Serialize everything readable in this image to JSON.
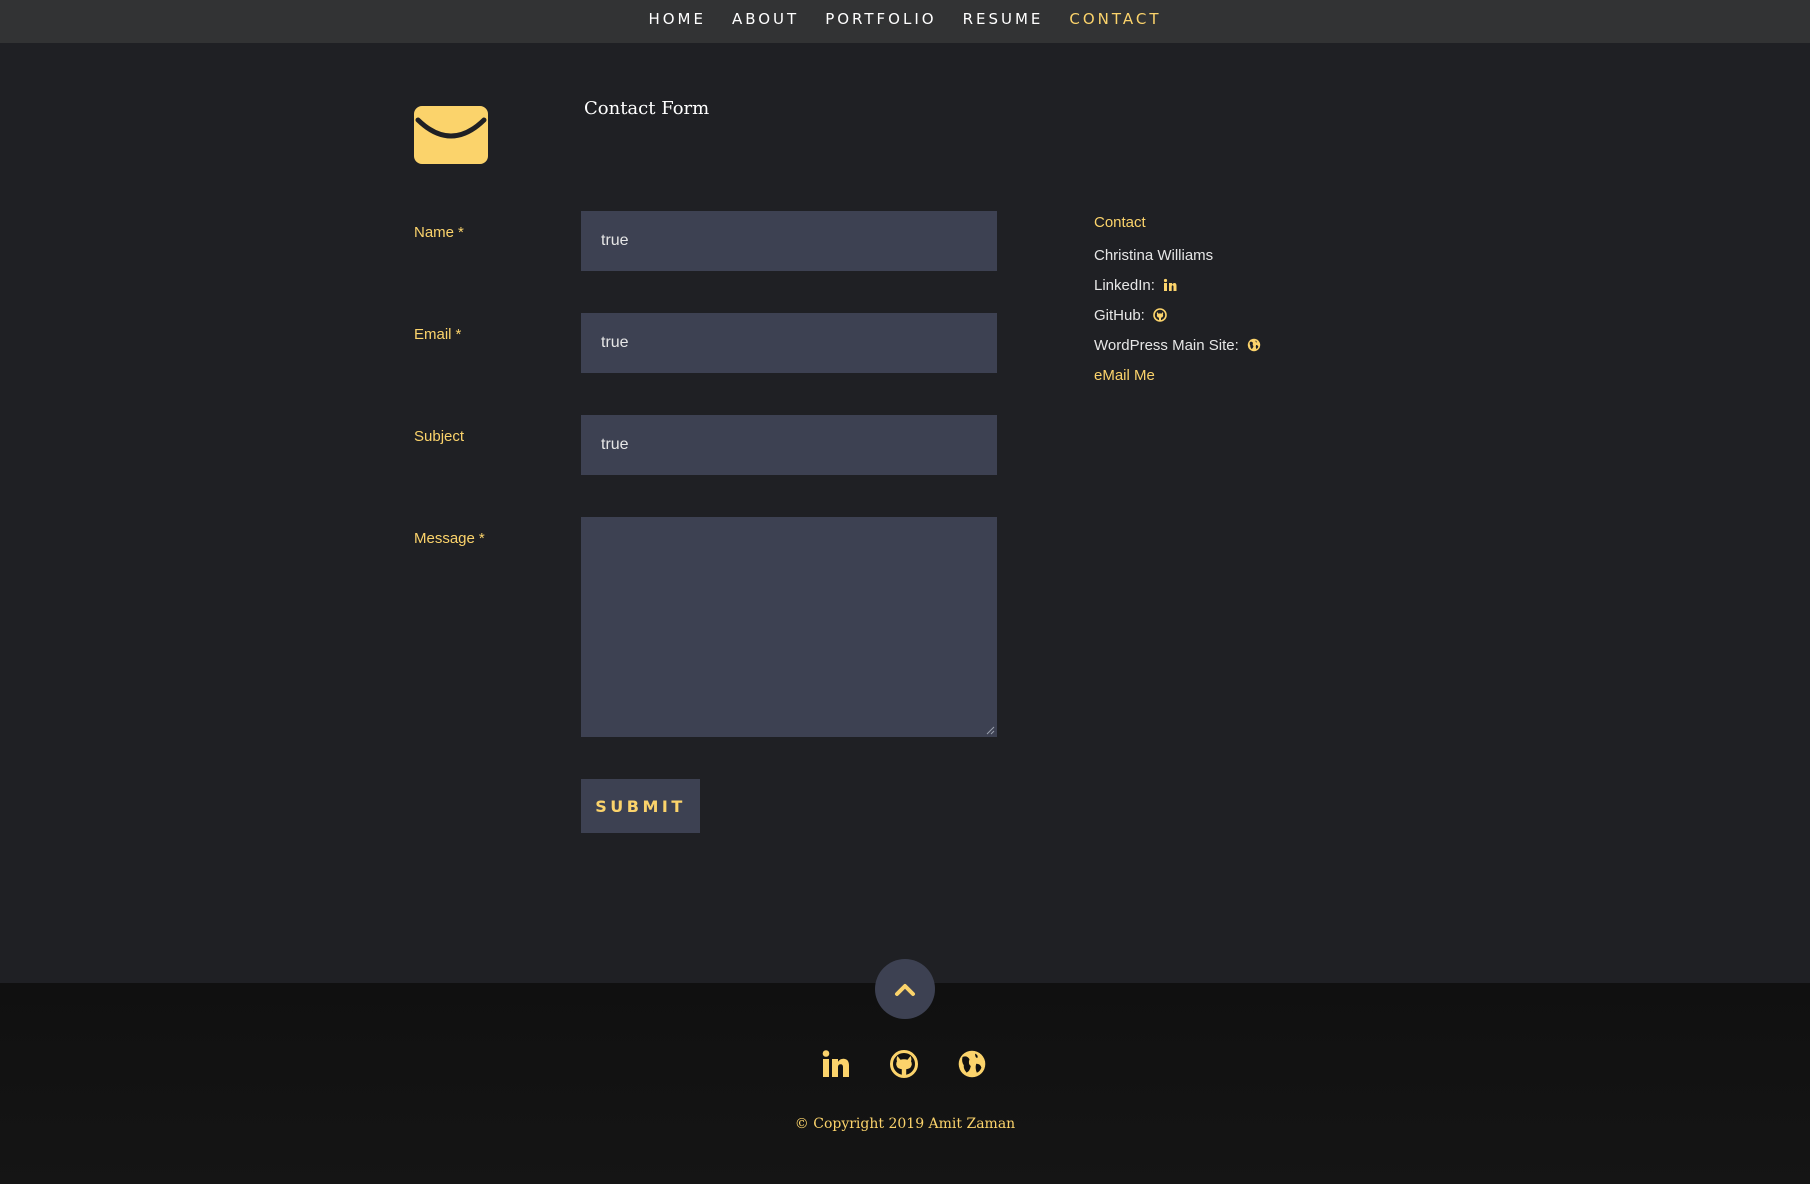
{
  "nav": {
    "items": [
      {
        "label": "HOME",
        "active": false
      },
      {
        "label": "ABOUT",
        "active": false
      },
      {
        "label": "PORTFOLIO",
        "active": false
      },
      {
        "label": "RESUME",
        "active": false
      },
      {
        "label": "CONTACT",
        "active": true
      }
    ]
  },
  "contact": {
    "icon": "envelope-icon",
    "form_title": "Contact Form",
    "fields": {
      "name": {
        "label": "Name",
        "required_mark": "*",
        "value": "true"
      },
      "email": {
        "label": "Email",
        "required_mark": "*",
        "value": "true"
      },
      "subject": {
        "label": "Subject",
        "value": "true"
      },
      "message": {
        "label": "Message",
        "required_mark": "*",
        "value": ""
      }
    },
    "submit_label": "SUBMIT"
  },
  "sidebar": {
    "heading": "Contact",
    "name": "Christina Williams",
    "linkedin_label": "LinkedIn:",
    "github_label": "GitHub:",
    "wordpress_label": "WordPress Main Site:",
    "email_link": "eMail Me"
  },
  "footer": {
    "social": [
      "linkedin-icon",
      "github-icon",
      "globe-icon"
    ],
    "copyright": "© Copyright 2019 Amit Zaman"
  },
  "colors": {
    "accent": "#fbd36b",
    "background": "#1f2024",
    "nav_bg": "#323334",
    "input_bg": "#3d4152",
    "footer_bg": "#101010"
  }
}
